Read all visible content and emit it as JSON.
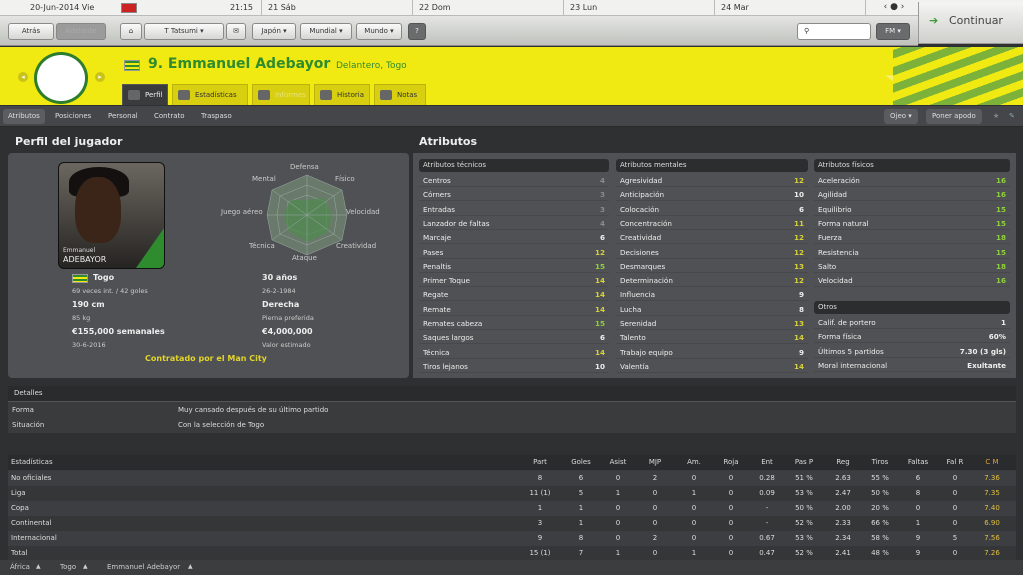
{
  "calendar": {
    "date": "20-Jun-2014 Vie",
    "time": "21:15",
    "days": [
      "21 Sáb",
      "22 Dom",
      "23 Lun",
      "24 Mar"
    ],
    "nav": "‹ ● ›"
  },
  "toolbar": {
    "back": "Atrás",
    "forward": "Adelante",
    "manager": "T Tatsumi",
    "japan": "Japón",
    "world_cup": "Mundial",
    "world": "Mundo",
    "help": "?",
    "fm": "FM",
    "continue": "Continuar"
  },
  "player": {
    "name": "9. Emmanuel Adebayor",
    "position": "Delantero, Togo"
  },
  "tabs": [
    "Perfil",
    "Estadísticas",
    "Informes",
    "Historia",
    "Notas"
  ],
  "subtabs": [
    "Atributos",
    "Posiciones",
    "Personal",
    "Contrato",
    "Traspaso"
  ],
  "subtab_buttons": {
    "scout": "Ojeo",
    "nickname": "Poner apodo"
  },
  "profile": {
    "title": "Perfil del jugador",
    "photo_first": "Emmanuel",
    "photo_last": "ADEBAYOR",
    "radar_labels": [
      "Defensa",
      "Físico",
      "Velocidad",
      "Creatividad",
      "Ataque",
      "Técnica",
      "Juego aéreo",
      "Mental"
    ],
    "nation": "Togo",
    "caps": "69 veces int. / 42 goles",
    "age": "30 años",
    "dob": "26-2-1984",
    "height": "190 cm",
    "weight": "85 kg",
    "foot": "Derecha",
    "foot_label": "Pierna preferida",
    "wage": "€155,000 semanales",
    "contract_end": "30-6-2016",
    "value": "€4,000,000",
    "value_label": "Valor estimado",
    "contract_note": "Contratado por el Man City"
  },
  "attributes": {
    "title": "Atributos",
    "technical": {
      "header": "Atributos técnicos",
      "rows": [
        [
          "Centros",
          "4"
        ],
        [
          "Córners",
          "3"
        ],
        [
          "Entradas",
          "3"
        ],
        [
          "Lanzador de faltas",
          "4"
        ],
        [
          "Marcaje",
          "6"
        ],
        [
          "Pases",
          "12"
        ],
        [
          "Penaltis",
          "15"
        ],
        [
          "Primer Toque",
          "14"
        ],
        [
          "Regate",
          "14"
        ],
        [
          "Remate",
          "14"
        ],
        [
          "Remates cabeza",
          "15"
        ],
        [
          "Saques largos",
          "6"
        ],
        [
          "Técnica",
          "14"
        ],
        [
          "Tiros lejanos",
          "10"
        ]
      ]
    },
    "mental": {
      "header": "Atributos mentales",
      "rows": [
        [
          "Agresividad",
          "12"
        ],
        [
          "Anticipación",
          "10"
        ],
        [
          "Colocación",
          "6"
        ],
        [
          "Concentración",
          "11"
        ],
        [
          "Creatividad",
          "12"
        ],
        [
          "Decisiones",
          "12"
        ],
        [
          "Desmarques",
          "13"
        ],
        [
          "Determinación",
          "12"
        ],
        [
          "Influencia",
          "9"
        ],
        [
          "Lucha",
          "8"
        ],
        [
          "Serenidad",
          "13"
        ],
        [
          "Talento",
          "14"
        ],
        [
          "Trabajo equipo",
          "9"
        ],
        [
          "Valentía",
          "14"
        ]
      ]
    },
    "physical": {
      "header": "Atributos físicos",
      "rows": [
        [
          "Aceleración",
          "16"
        ],
        [
          "Agilidad",
          "16"
        ],
        [
          "Equilibrio",
          "15"
        ],
        [
          "Forma natural",
          "15"
        ],
        [
          "Fuerza",
          "18"
        ],
        [
          "Resistencia",
          "15"
        ],
        [
          "Salto",
          "18"
        ],
        [
          "Velocidad",
          "16"
        ]
      ]
    },
    "other": {
      "header": "Otros",
      "rows": [
        [
          "Calif. de portero",
          "1"
        ],
        [
          "Forma física",
          "60%"
        ],
        [
          "Últimos 5 partidos",
          "7.30 (3 gls)"
        ],
        [
          "Moral internacional",
          "Exultante"
        ]
      ]
    }
  },
  "details": {
    "header": "Detalles",
    "rows": [
      [
        "Forma",
        "Muy cansado después de su último partido"
      ],
      [
        "Situación",
        "Con la selección de Togo"
      ]
    ]
  },
  "stats": {
    "headers": [
      "Estadísticas",
      "Part",
      "Goles",
      "Asist",
      "MJP",
      "Am.",
      "Roja",
      "Ent",
      "Pas P",
      "Reg",
      "Tiros",
      "Faltas",
      "Fal R",
      "C M"
    ],
    "rows": [
      [
        "No oficiales",
        "8",
        "6",
        "0",
        "2",
        "0",
        "0",
        "0.28",
        "51 %",
        "2.63",
        "55 %",
        "6",
        "0",
        "7.36"
      ],
      [
        "Liga",
        "11 (1)",
        "5",
        "1",
        "0",
        "1",
        "0",
        "0.09",
        "53 %",
        "2.47",
        "50 %",
        "8",
        "0",
        "7.35"
      ],
      [
        "Copa",
        "1",
        "1",
        "0",
        "0",
        "0",
        "0",
        "-",
        "50 %",
        "2.00",
        "20 %",
        "0",
        "0",
        "7.40"
      ],
      [
        "Continental",
        "3",
        "1",
        "0",
        "0",
        "0",
        "0",
        "-",
        "52 %",
        "2.33",
        "66 %",
        "1",
        "0",
        "6.90"
      ],
      [
        "Internacional",
        "9",
        "8",
        "0",
        "2",
        "0",
        "0",
        "0.67",
        "53 %",
        "2.34",
        "58 %",
        "9",
        "5",
        "7.56"
      ],
      [
        "Total",
        "15 (1)",
        "7",
        "1",
        "0",
        "1",
        "0",
        "0.47",
        "52 %",
        "2.41",
        "48 %",
        "9",
        "0",
        "7.26"
      ]
    ]
  },
  "footer": [
    "África",
    "Togo",
    "Emmanuel Adebayor"
  ],
  "colors": {
    "good": "#8ed13a",
    "mid": "#d6d13a",
    "low": "#8a8a8a",
    "header_yellow": "#f1ea12",
    "green": "#2e8b2e"
  }
}
